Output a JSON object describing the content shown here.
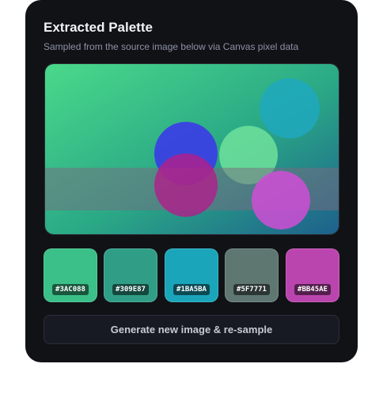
{
  "card": {
    "title": "Extracted Palette",
    "subtitle": "Sampled from the source image below via Canvas pixel data"
  },
  "palette": [
    {
      "hex": "#3AC088",
      "label": "#3AC088"
    },
    {
      "hex": "#309E87",
      "label": "#309E87"
    },
    {
      "hex": "#1BA5BA",
      "label": "#1BA5BA"
    },
    {
      "hex": "#5F7771",
      "label": "#5F7771"
    },
    {
      "hex": "#BB45AE",
      "label": "#BB45AE"
    }
  ],
  "action": {
    "label": "Generate new image & re-sample"
  },
  "colors": {
    "card_bg": "#111216",
    "gradient_start": "#4ad98a",
    "gradient_mid": "#2aa886",
    "gradient_end": "#1d5f8c",
    "circle_blue": "#3b3be8",
    "circle_light_green": "#5ed991",
    "circle_magenta": "#b0208a",
    "circle_pink": "#c94bd0",
    "circle_cyan": "#1fa8be"
  }
}
